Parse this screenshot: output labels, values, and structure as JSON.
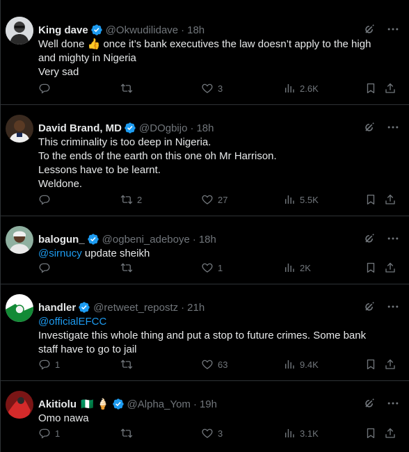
{
  "icons": {
    "verified": "verified-badge-icon",
    "grok": "grok-icon",
    "more": "more-icon",
    "reply": "reply-icon",
    "retweet": "retweet-icon",
    "like": "like-icon",
    "views": "views-icon",
    "bookmark": "bookmark-icon",
    "share": "share-icon"
  },
  "colors": {
    "background": "#000000",
    "text": "#e7e9ea",
    "muted": "#71767b",
    "link": "#1d9bf0",
    "border": "#2f3336"
  },
  "tweets": [
    {
      "name": "King dave",
      "handle": "@Okwudilidave",
      "time": "18h",
      "lines": [
        "Well done 👍 once it’s bank executives the law doesn’t apply to the high",
        "and mighty in Nigeria",
        "Very sad"
      ],
      "replies": "",
      "retweets": "",
      "likes": "3",
      "views": "2.6K"
    },
    {
      "name": "David Brand, MD",
      "handle": "@DOgbijo",
      "time": "18h",
      "lines": [
        "This criminality is too deep in Nigeria.",
        "To the ends of the earth on this one oh Mr Harrison.",
        "Lessons have to be learnt.",
        "Weldone."
      ],
      "replies": "",
      "retweets": "2",
      "likes": "27",
      "views": "5.5K"
    },
    {
      "name": "balogun_",
      "handle": "@ogbeni_adeboye",
      "time": "18h",
      "mention": "@sirnucy",
      "text_after": " update sheikh",
      "replies": "",
      "retweets": "",
      "likes": "1",
      "views": "2K"
    },
    {
      "name": "handler",
      "handle": "@retweet_repostz",
      "time": "21h",
      "mention": "@officialEFCC",
      "lines": [
        "Investigate this whole thing and put a stop to future crimes. Some bank",
        "staff have to go to jail"
      ],
      "replies": "1",
      "retweets": "",
      "likes": "63",
      "views": "9.4K"
    },
    {
      "name": "Akitiolu",
      "name_emoji": "🇳🇬 🍦",
      "handle": "@Alpha_Yom",
      "time": "19h",
      "lines": [
        "Omo nawa"
      ],
      "replies": "1",
      "retweets": "",
      "likes": "3",
      "views": "3.1K"
    }
  ],
  "separator": "·"
}
